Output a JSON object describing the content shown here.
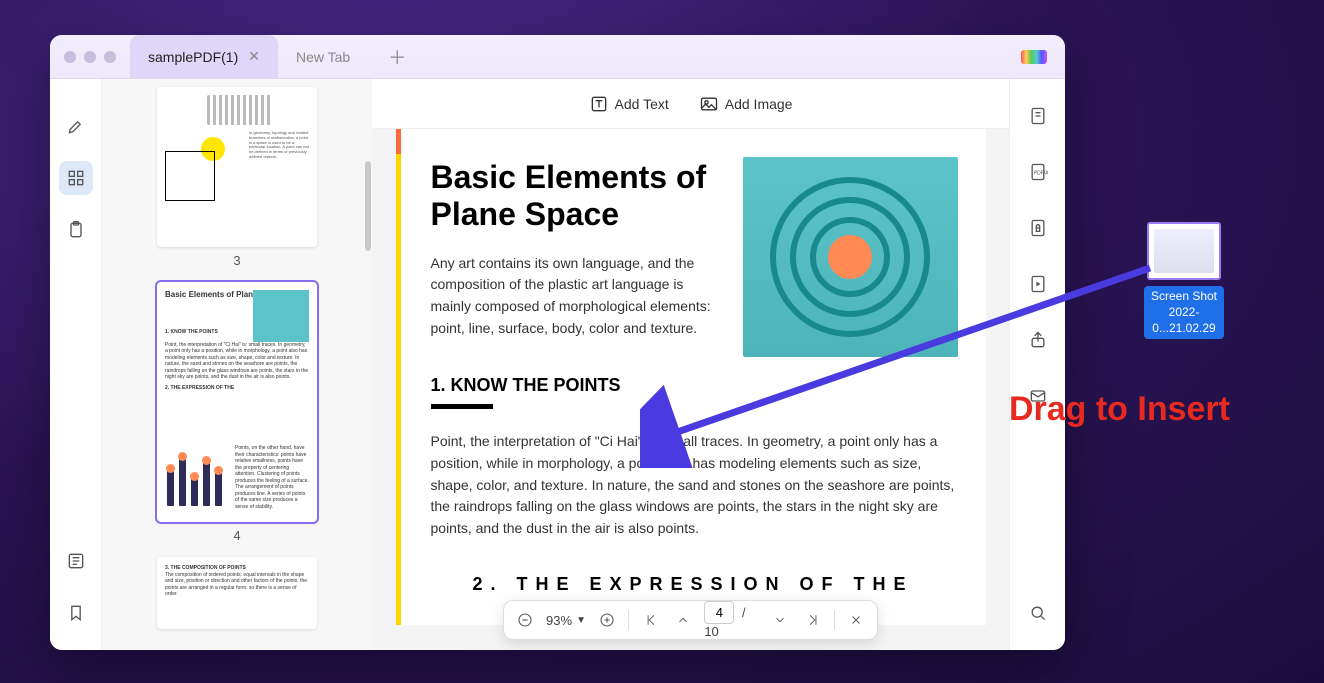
{
  "tabs": [
    {
      "title": "samplePDF(1)",
      "active": true
    },
    {
      "title": "New Tab",
      "active": false
    }
  ],
  "topActions": {
    "addText": "Add Text",
    "addImage": "Add Image"
  },
  "thumbnails": {
    "page3": {
      "num": "3",
      "lorem": "In geometry, topology and related branches of mathematics, a point is a space is used to be a particular location. A point can not be defined in terms of previously defined objects."
    },
    "page4": {
      "num": "4",
      "title": "Basic Elements of Plane Space",
      "sec1": "1. KNOW THE POINTS",
      "sec2": "2. THE EXPRESSION OF THE",
      "small1": "Point, the interpretation of \"Ci Hai\" is: small traces. In geometry, a point only has a position, while in morphology, a point also has modeling elements such as size, shape, color and texture. In nature, the sand and stones on the seashore are points, the raindrops falling on the glass windows are points, the stars in the night sky are points, and the dust in the air is also points.",
      "small2": "Points, on the other hand, have their characteristics: points have relative smallness, points have the property of centering attention. Clustering of points produces the feeling of a surface. The arrangement of points produces line. A series of points of the same size produces a sense of stability."
    },
    "page5": {
      "sec": "3. THE COMPOSITION OF POINTS",
      "small": "The composition of ordered points: equal intervals in the shape and size, position or direction and other factors of the points, the points are arranged in a regular form, so there is a sense of order."
    }
  },
  "page": {
    "title": "Basic Elements of Plane Space",
    "intro": "Any art contains its own language, and the composition of the plastic art language is mainly composed of morphological elements: point, line, surface, body, color and texture.",
    "h2a": "1. KNOW THE POINTS",
    "body": "Point, the interpretation of \"Ci Hai\" is: small traces. In geometry, a point only has a position, while in morphology, a point also has modeling elements such as size, shape, color, and texture. In nature, the sand and stones on the seashore are points, the raindrops falling on the glass windows are points, the stars in the night sky are points, and the dust in the air is also points.",
    "h2b": "2. THE  EXPRESSION  OF  THE"
  },
  "bottomBar": {
    "zoom": "93%",
    "page": "4",
    "total": "10"
  },
  "desktopFile": {
    "line1": "Screen Shot",
    "line2": "2022-0...21.02.29"
  },
  "callout": "Drag to Insert"
}
